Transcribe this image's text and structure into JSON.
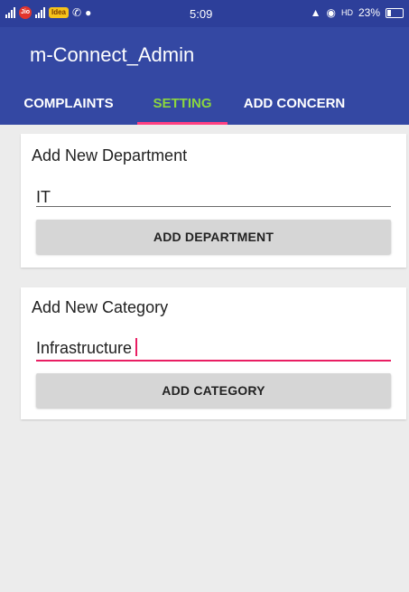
{
  "status_bar": {
    "time": "5:09",
    "jio_label": "Jio",
    "idea_label": "Idea",
    "hd_label": "HD",
    "battery": "23%"
  },
  "app": {
    "title": "m-Connect_Admin"
  },
  "tabs": [
    {
      "label": "COMPLAINTS"
    },
    {
      "label": "SETTING"
    },
    {
      "label": "ADD CONCERN"
    }
  ],
  "active_tab_index": 1,
  "department": {
    "title": "Add New Department",
    "value": "IT",
    "button_label": "ADD DEPARTMENT"
  },
  "category": {
    "title": "Add New Category",
    "value": "Infrastructure",
    "button_label": "ADD CATEGORY"
  },
  "colors": {
    "app_bar": "#3448a3",
    "status_bar": "#2d3f9a",
    "active_tab": "#8bd63f",
    "indicator": "#ff4081",
    "focus_line": "#e91e63"
  },
  "icons": [
    "signal-icon",
    "jio-icon",
    "idea-icon",
    "whatsapp-icon",
    "notification-icon",
    "alarm-icon",
    "eye-icon",
    "volte-icon",
    "battery-icon"
  ]
}
